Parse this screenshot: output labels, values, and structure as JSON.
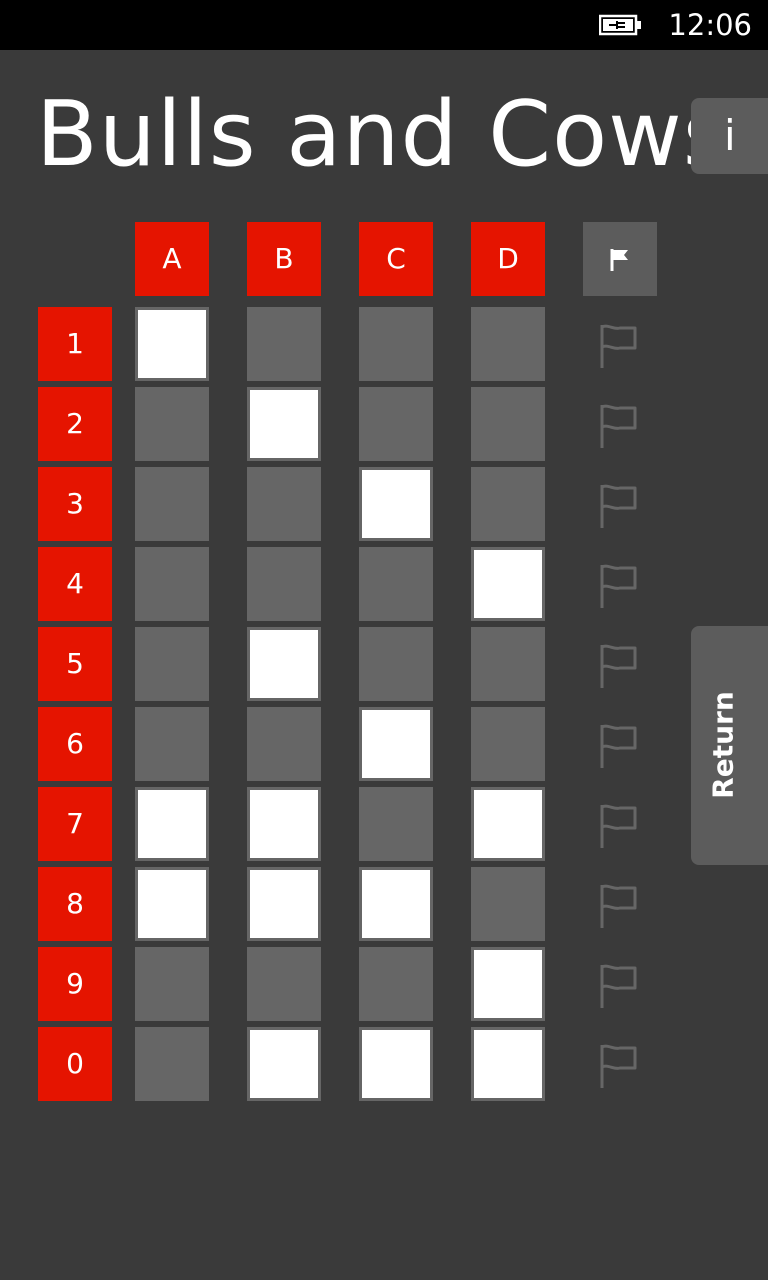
{
  "status_bar": {
    "time": "12:06",
    "battery_icon": "battery-charging-icon"
  },
  "app": {
    "title": "Bulls and Cows",
    "info_label": "i",
    "return_label": "Return"
  },
  "colors": {
    "accent": "#e51400",
    "cell_off": "#666666",
    "cell_on": "#ffffff",
    "background": "#3a3a3a"
  },
  "grid": {
    "columns": [
      "A",
      "B",
      "C",
      "D"
    ],
    "flag_header_icon": "flag-icon",
    "rows": [
      {
        "digit": "1",
        "marks": [
          true,
          false,
          false,
          false
        ]
      },
      {
        "digit": "2",
        "marks": [
          false,
          true,
          false,
          false
        ]
      },
      {
        "digit": "3",
        "marks": [
          false,
          false,
          true,
          false
        ]
      },
      {
        "digit": "4",
        "marks": [
          false,
          false,
          false,
          true
        ]
      },
      {
        "digit": "5",
        "marks": [
          false,
          true,
          false,
          false
        ]
      },
      {
        "digit": "6",
        "marks": [
          false,
          false,
          true,
          false
        ]
      },
      {
        "digit": "7",
        "marks": [
          true,
          true,
          false,
          true
        ]
      },
      {
        "digit": "8",
        "marks": [
          true,
          true,
          true,
          false
        ]
      },
      {
        "digit": "9",
        "marks": [
          false,
          false,
          false,
          true
        ]
      },
      {
        "digit": "0",
        "marks": [
          false,
          true,
          true,
          true
        ]
      }
    ],
    "row_flag_icon": "flag-outline-icon"
  }
}
